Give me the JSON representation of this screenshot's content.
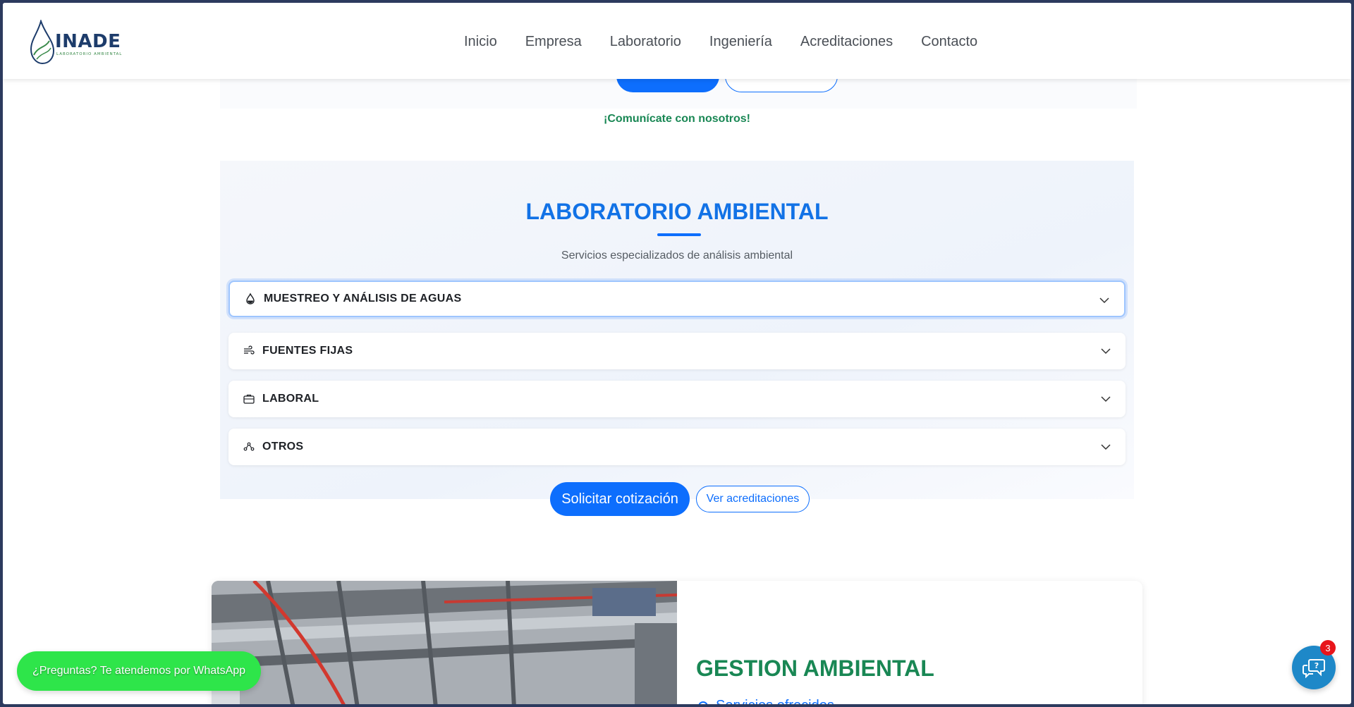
{
  "brand": {
    "name": "INADE",
    "subtitle": "LABORATORIO AMBIENTAL"
  },
  "nav": {
    "items": [
      "Inicio",
      "Empresa",
      "Laboratorio",
      "Ingeniería",
      "Acreditaciones",
      "Contacto"
    ]
  },
  "hero": {
    "tagline": "¡Comunícate con nosotros!"
  },
  "lab": {
    "title": "LABORATORIO AMBIENTAL",
    "subtitle": "Servicios especializados de análisis ambiental",
    "accordion": [
      {
        "label": "MUESTREO Y ANÁLISIS DE AGUAS",
        "icon": "water-drop-icon",
        "expanded": false,
        "focused": true
      },
      {
        "label": "FUENTES FIJAS",
        "icon": "wind-icon",
        "expanded": false,
        "focused": false
      },
      {
        "label": "LABORAL",
        "icon": "briefcase-icon",
        "expanded": false,
        "focused": false
      },
      {
        "label": "OTROS",
        "icon": "network-icon",
        "expanded": false,
        "focused": false
      }
    ],
    "primary_button": "Solicitar cotización",
    "secondary_button": "Ver acreditaciones"
  },
  "gestion": {
    "title": "GESTION AMBIENTAL",
    "subtitle": "Servicios ofrecidos"
  },
  "whatsapp": {
    "label": "¿Preguntas? Te atendemos por WhatsApp"
  },
  "chat": {
    "badge": "3"
  },
  "colors": {
    "primary": "#0d6efd",
    "green": "#198754",
    "whatsapp": "#2ee54a",
    "badge": "#e8151b"
  }
}
